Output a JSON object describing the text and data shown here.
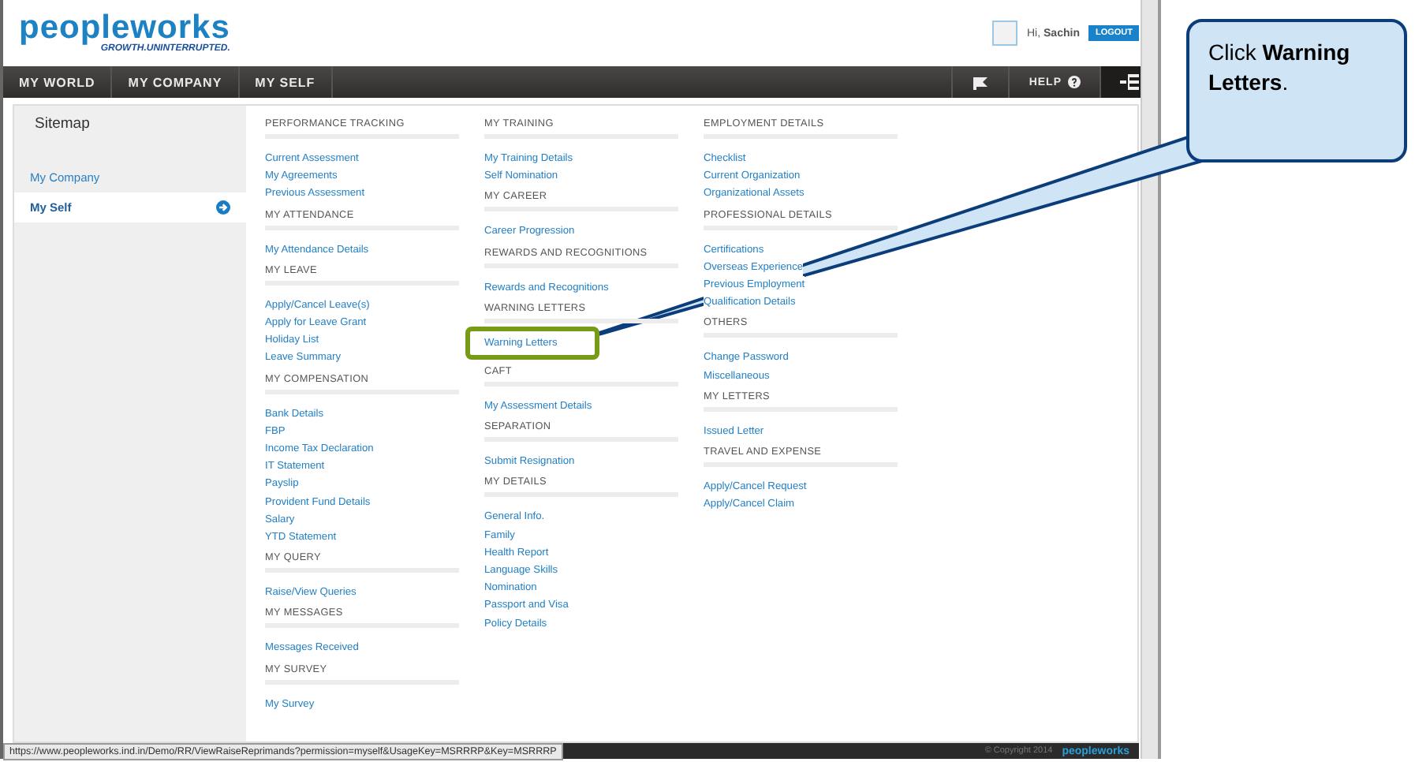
{
  "header": {
    "logo": {
      "text": "peopleworks",
      "tagline": "GROWTH.UNINTERRUPTED."
    },
    "greeting": "Hi,",
    "user": "Sachin",
    "logout": "LOGOUT"
  },
  "nav": {
    "items": [
      {
        "label": "MY WORLD"
      },
      {
        "label": "MY COMPANY"
      },
      {
        "label": "MY SELF"
      }
    ],
    "help": "HELP"
  },
  "sidebar": {
    "title": "Sitemap",
    "items": [
      {
        "label": "My Company",
        "selected": false
      },
      {
        "label": "My Self",
        "selected": true
      }
    ]
  },
  "columns": [
    [
      {
        "heading": "PERFORMANCE TRACKING",
        "links": [
          {
            "label": "Current Assessment"
          },
          {
            "label": "My Agreements"
          },
          {
            "label": "Previous Assessment"
          }
        ]
      },
      {
        "heading": "MY ATTENDANCE",
        "links": [
          {
            "label": "My Attendance Details"
          }
        ]
      },
      {
        "heading": "MY LEAVE",
        "links": [
          {
            "label": "Apply/Cancel Leave(s)"
          },
          {
            "label": "Apply for Leave Grant"
          },
          {
            "label": "Holiday List"
          },
          {
            "label": "Leave Summary"
          }
        ]
      },
      {
        "heading": "MY COMPENSATION",
        "links": [
          {
            "label": "Bank Details"
          },
          {
            "label": "FBP"
          },
          {
            "label": "Income Tax Declaration"
          },
          {
            "label": "IT Statement"
          },
          {
            "label": "Payslip"
          },
          {
            "label": "Provident Fund Details"
          },
          {
            "label": "Salary"
          },
          {
            "label": "YTD Statement"
          }
        ]
      },
      {
        "heading": "MY QUERY",
        "links": [
          {
            "label": "Raise/View Queries"
          }
        ]
      },
      {
        "heading": "MY MESSAGES",
        "links": [
          {
            "label": "Messages Received"
          }
        ]
      },
      {
        "heading": "MY SURVEY",
        "links": [
          {
            "label": "My Survey"
          }
        ]
      }
    ],
    [
      {
        "heading": "MY TRAINING",
        "links": [
          {
            "label": "My Training Details"
          },
          {
            "label": "Self Nomination"
          }
        ]
      },
      {
        "heading": "MY CAREER",
        "links": [
          {
            "label": "Career Progression"
          }
        ]
      },
      {
        "heading": "REWARDS AND RECOGNITIONS",
        "links": [
          {
            "label": "Rewards and Recognitions"
          }
        ]
      },
      {
        "heading": "WARNING LETTERS",
        "links": [
          {
            "label": "Warning Letters",
            "highlighted": true
          }
        ]
      },
      {
        "heading": "CAFT",
        "links": [
          {
            "label": "My Assessment Details"
          }
        ]
      },
      {
        "heading": "SEPARATION",
        "links": [
          {
            "label": "Submit Resignation"
          }
        ]
      },
      {
        "heading": "MY DETAILS",
        "links": [
          {
            "label": "General Info."
          },
          {
            "label": "Family"
          },
          {
            "label": "Health Report"
          },
          {
            "label": "Language Skills"
          },
          {
            "label": "Nomination"
          },
          {
            "label": "Passport and Visa"
          },
          {
            "label": "Policy Details"
          }
        ]
      }
    ],
    [
      {
        "heading": "EMPLOYMENT DETAILS",
        "links": [
          {
            "label": "Checklist"
          },
          {
            "label": "Current Organization"
          },
          {
            "label": "Organizational Assets"
          }
        ]
      },
      {
        "heading": "PROFESSIONAL DETAILS",
        "links": [
          {
            "label": "Certifications"
          },
          {
            "label": "Overseas Experience"
          },
          {
            "label": "Previous Employment"
          },
          {
            "label": "Qualification Details"
          }
        ]
      },
      {
        "heading": "OTHERS",
        "links": [
          {
            "label": "Change Password"
          },
          {
            "label": "Miscellaneous"
          }
        ]
      },
      {
        "heading": "MY LETTERS",
        "links": [
          {
            "label": "Issued Letter"
          }
        ]
      },
      {
        "heading": "TRAVEL AND EXPENSE",
        "links": [
          {
            "label": "Apply/Cancel Request"
          },
          {
            "label": "Apply/Cancel Claim"
          }
        ]
      }
    ]
  ],
  "status_bar": {
    "url": "https://www.peopleworks.ind.in/Demo/RR/ViewRaiseReprimands?permission=myself&UsageKey=MSRRRP&Key=MSRRRP",
    "copyright": "© Copyright 2014",
    "logo": "peopleworks"
  },
  "callout": {
    "text": "Click **Warning Letters**."
  }
}
